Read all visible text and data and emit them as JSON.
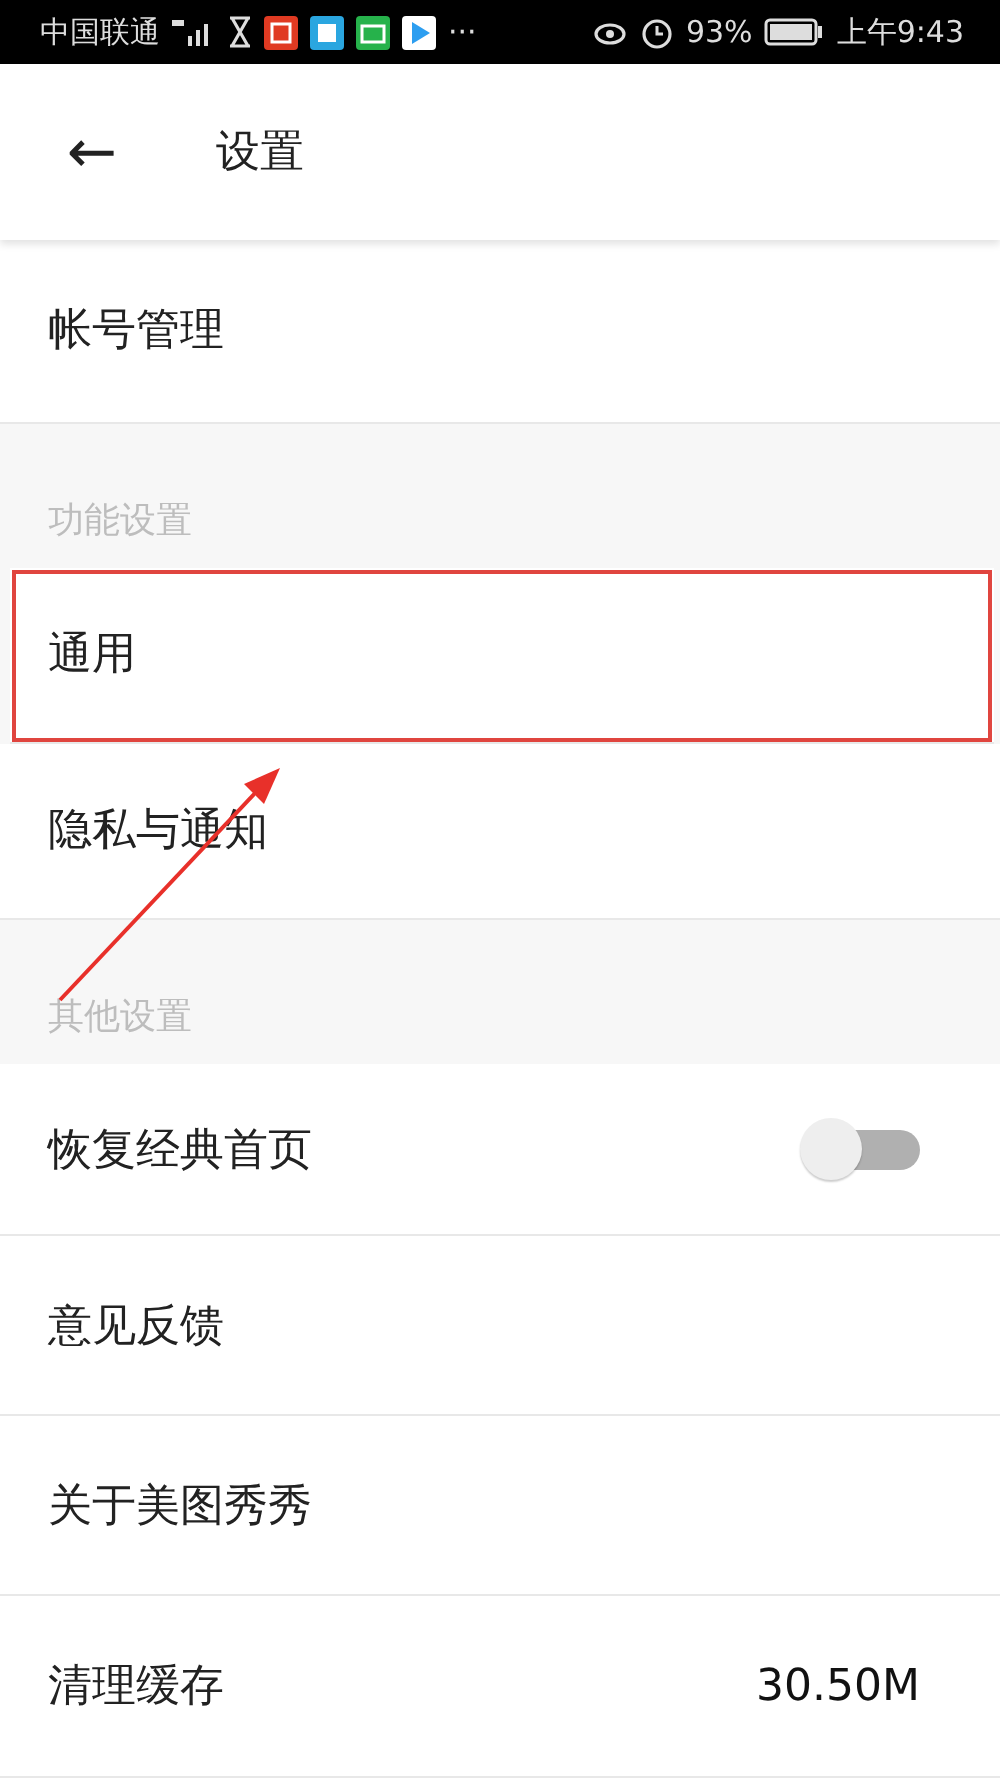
{
  "status_bar": {
    "carrier": "中国联通",
    "battery": "93%",
    "time": "上午9:43",
    "more": "···"
  },
  "header": {
    "back": "←",
    "title": "设置"
  },
  "groups": [
    {
      "items": [
        {
          "kind": "link",
          "label": "帐号管理",
          "highlighted": false
        }
      ]
    },
    {
      "title": "功能设置",
      "items": [
        {
          "kind": "link",
          "label": "通用",
          "highlighted": true
        },
        {
          "kind": "link",
          "label": "隐私与通知",
          "highlighted": false
        }
      ]
    },
    {
      "title": "其他设置",
      "items": [
        {
          "kind": "toggle",
          "label": "恢复经典首页",
          "on": false,
          "highlighted": false
        },
        {
          "kind": "link",
          "label": "意见反馈",
          "highlighted": false
        },
        {
          "kind": "link",
          "label": "关于美图秀秀",
          "highlighted": false
        },
        {
          "kind": "value",
          "label": "清理缓存",
          "value": "30.50M",
          "highlighted": false
        }
      ]
    }
  ]
}
